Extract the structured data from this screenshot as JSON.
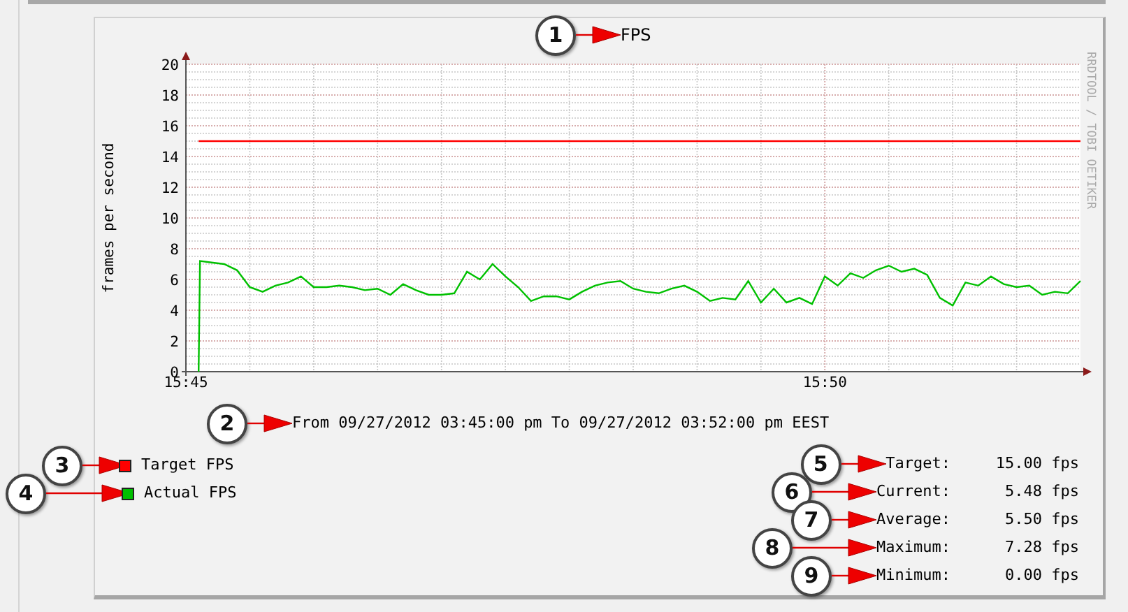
{
  "graph": {
    "title_callout": "1",
    "credit": "RRDTOOL / TOBI OETIKER",
    "chart_data": {
      "type": "line",
      "grid": true,
      "title": "FPS",
      "ylabel": "frames per second",
      "xlim": [
        945,
        952
      ],
      "ylim": [
        0,
        20
      ],
      "xticks": [
        {
          "value": 945,
          "label": "15:45"
        },
        {
          "value": 950,
          "label": "15:50"
        }
      ],
      "yticks": [
        0,
        2,
        4,
        6,
        8,
        10,
        12,
        14,
        16,
        18,
        20
      ],
      "x": [
        945.1,
        945.11,
        945.2,
        945.3,
        945.4,
        945.5,
        945.6,
        945.7,
        945.8,
        945.9,
        946.0,
        946.1,
        946.2,
        946.3,
        946.4,
        946.5,
        946.6,
        946.7,
        946.8,
        946.9,
        947.0,
        947.1,
        947.2,
        947.3,
        947.4,
        947.5,
        947.6,
        947.7,
        947.8,
        947.9,
        948.0,
        948.1,
        948.2,
        948.3,
        948.4,
        948.5,
        948.6,
        948.7,
        948.8,
        948.9,
        949.0,
        949.1,
        949.2,
        949.3,
        949.4,
        949.5,
        949.6,
        949.7,
        949.8,
        949.9,
        950.0,
        950.1,
        950.2,
        950.3,
        950.4,
        950.5,
        950.6,
        950.7,
        950.8,
        950.9,
        951.0,
        951.1,
        951.2,
        951.3,
        951.4,
        951.5,
        951.6,
        951.7,
        951.8,
        951.9,
        952.0
      ],
      "series": [
        {
          "name": "Target FPS",
          "color": "#ff0000",
          "values": [
            15,
            15,
            15,
            15,
            15,
            15,
            15,
            15,
            15,
            15,
            15,
            15,
            15,
            15,
            15,
            15,
            15,
            15,
            15,
            15,
            15,
            15,
            15,
            15,
            15,
            15,
            15,
            15,
            15,
            15,
            15,
            15,
            15,
            15,
            15,
            15,
            15,
            15,
            15,
            15,
            15,
            15,
            15,
            15,
            15,
            15,
            15,
            15,
            15,
            15,
            15,
            15,
            15,
            15,
            15,
            15,
            15,
            15,
            15,
            15,
            15,
            15,
            15,
            15,
            15,
            15,
            15,
            15,
            15,
            15,
            15
          ]
        },
        {
          "name": "Actual FPS",
          "color": "#00c000",
          "values": [
            0,
            7.2,
            7.1,
            7.0,
            6.6,
            5.5,
            5.2,
            5.6,
            5.8,
            6.2,
            5.5,
            5.5,
            5.6,
            5.5,
            5.3,
            5.4,
            5.0,
            5.7,
            5.3,
            5.0,
            5.0,
            5.1,
            6.5,
            6.0,
            7.0,
            6.2,
            5.5,
            4.6,
            4.9,
            4.9,
            4.7,
            5.2,
            5.6,
            5.8,
            5.9,
            5.4,
            5.2,
            5.1,
            5.4,
            5.6,
            5.2,
            4.6,
            4.8,
            4.7,
            5.9,
            4.5,
            5.4,
            4.5,
            4.8,
            4.4,
            6.2,
            5.6,
            6.4,
            6.1,
            6.6,
            6.9,
            6.5,
            6.7,
            6.3,
            4.8,
            4.3,
            5.8,
            5.6,
            6.2,
            5.7,
            5.5,
            5.6,
            5.0,
            5.2,
            5.1,
            5.9
          ]
        }
      ]
    }
  },
  "period": {
    "callout": "2",
    "text": "From 09/27/2012 03:45:00 pm To 09/27/2012 03:52:00 pm EEST"
  },
  "legend": [
    {
      "callout": "3"
    },
    {
      "callout": "4"
    }
  ],
  "stats": [
    {
      "callout": "5",
      "label": "Target:",
      "value": "15.00 fps"
    },
    {
      "callout": "6",
      "label": "Current:",
      "value": "5.48 fps"
    },
    {
      "callout": "7",
      "label": "Average:",
      "value": "5.50 fps"
    },
    {
      "callout": "8",
      "label": "Maximum:",
      "value": "7.28 fps"
    },
    {
      "callout": "9",
      "label": "Minimum:",
      "value": "0.00 fps"
    }
  ]
}
